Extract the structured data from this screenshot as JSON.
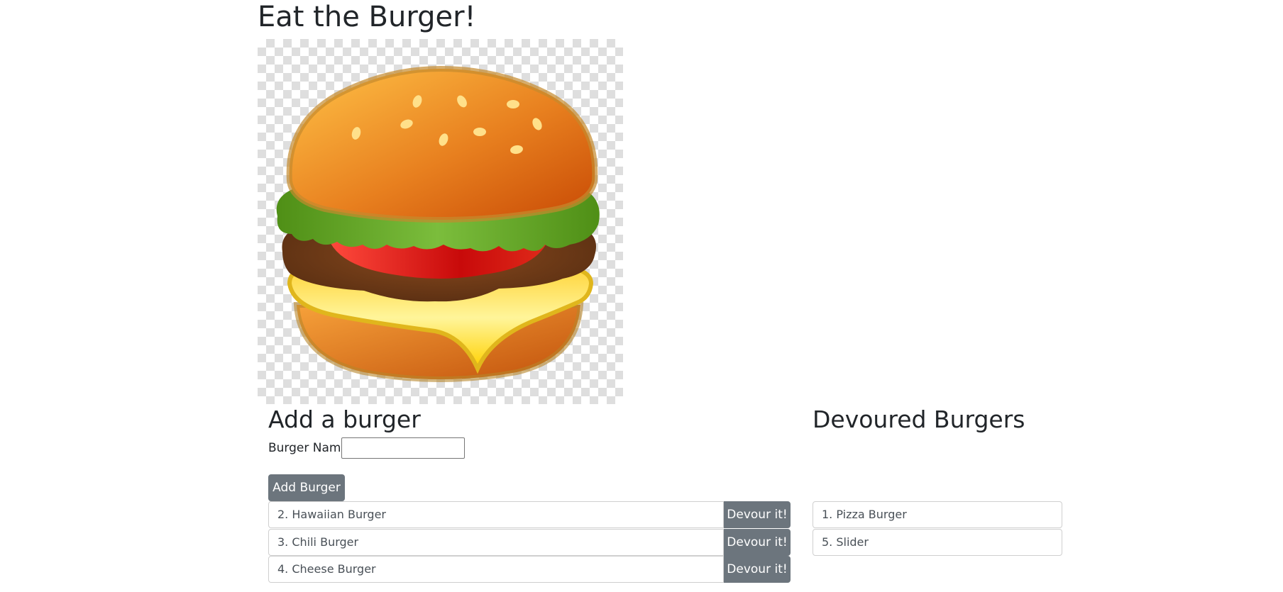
{
  "page": {
    "title": "Eat the Burger!"
  },
  "hero": {
    "icon": "burger-image"
  },
  "add_section": {
    "title": "Add a burger",
    "name_label": "Burger Name:",
    "name_value": "",
    "name_placeholder": "",
    "add_button_label": "Add Burger"
  },
  "burgers": [
    {
      "label": "2. Hawaiian Burger",
      "button_label": "Devour it!"
    },
    {
      "label": "3. Chili Burger",
      "button_label": "Devour it!"
    },
    {
      "label": "4. Cheese Burger",
      "button_label": "Devour it!"
    }
  ],
  "devoured_section": {
    "title": "Devoured Burgers"
  },
  "devoured": [
    {
      "label": "1. Pizza Burger"
    },
    {
      "label": "5. Slider"
    }
  ],
  "colors": {
    "button_bg": "#6c757d",
    "button_text": "#ffffff",
    "text": "#212529",
    "list_border": "#cfcfcf"
  }
}
